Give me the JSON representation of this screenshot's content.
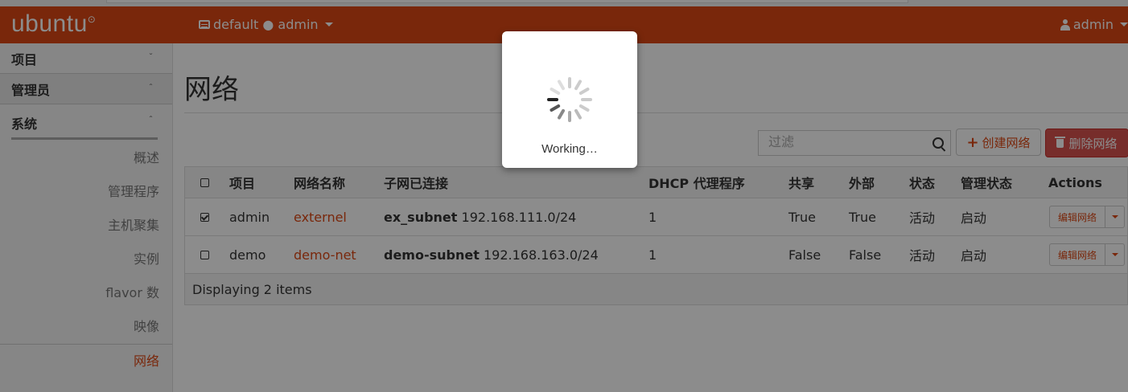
{
  "topbar": {
    "brand": "ubuntu",
    "brand_mark": "⊙",
    "context": "default ● admin",
    "user": "admin",
    "icon_project": "project-icon",
    "icon_user": "user-icon"
  },
  "sidebar": {
    "sections": [
      {
        "label": "项目",
        "chevron": "ˇ"
      },
      {
        "label": "管理员",
        "chevron": "ˆ"
      }
    ],
    "group": {
      "label": "系统",
      "chevron": "ˆ"
    },
    "items": [
      {
        "label": "概述"
      },
      {
        "label": "管理程序"
      },
      {
        "label": "主机聚集"
      },
      {
        "label": "实例"
      },
      {
        "label": "flavor 数"
      },
      {
        "label": "映像"
      },
      {
        "label": "网络"
      }
    ]
  },
  "main": {
    "title": "网络",
    "filter_placeholder": "过滤",
    "create_button": "创建网络",
    "create_plus": "+",
    "delete_button": "删除网络",
    "table": {
      "columns": [
        "项目",
        "网络名称",
        "子网已连接",
        "DHCP 代理程序",
        "共享",
        "外部",
        "状态",
        "管理状态",
        "Actions"
      ],
      "rows": [
        {
          "checked": true,
          "project": "admin",
          "name": "externel",
          "subnet_name": "ex_subnet",
          "subnet_cidr": "192.168.111.0/24",
          "dhcp": "1",
          "shared": "True",
          "external": "True",
          "status": "活动",
          "admin_state": "启动",
          "action": "编辑网络"
        },
        {
          "checked": false,
          "project": "demo",
          "name": "demo-net",
          "subnet_name": "demo-subnet",
          "subnet_cidr": "192.168.163.0/24",
          "dhcp": "1",
          "shared": "False",
          "external": "False",
          "status": "活动",
          "admin_state": "启动",
          "action": "编辑网络"
        }
      ],
      "footer": "Displaying 2 items"
    }
  },
  "modal": {
    "text": "Working…",
    "icon": "spinner-icon"
  },
  "colors": {
    "brand": "#dd4814",
    "danger": "#d9534f"
  }
}
